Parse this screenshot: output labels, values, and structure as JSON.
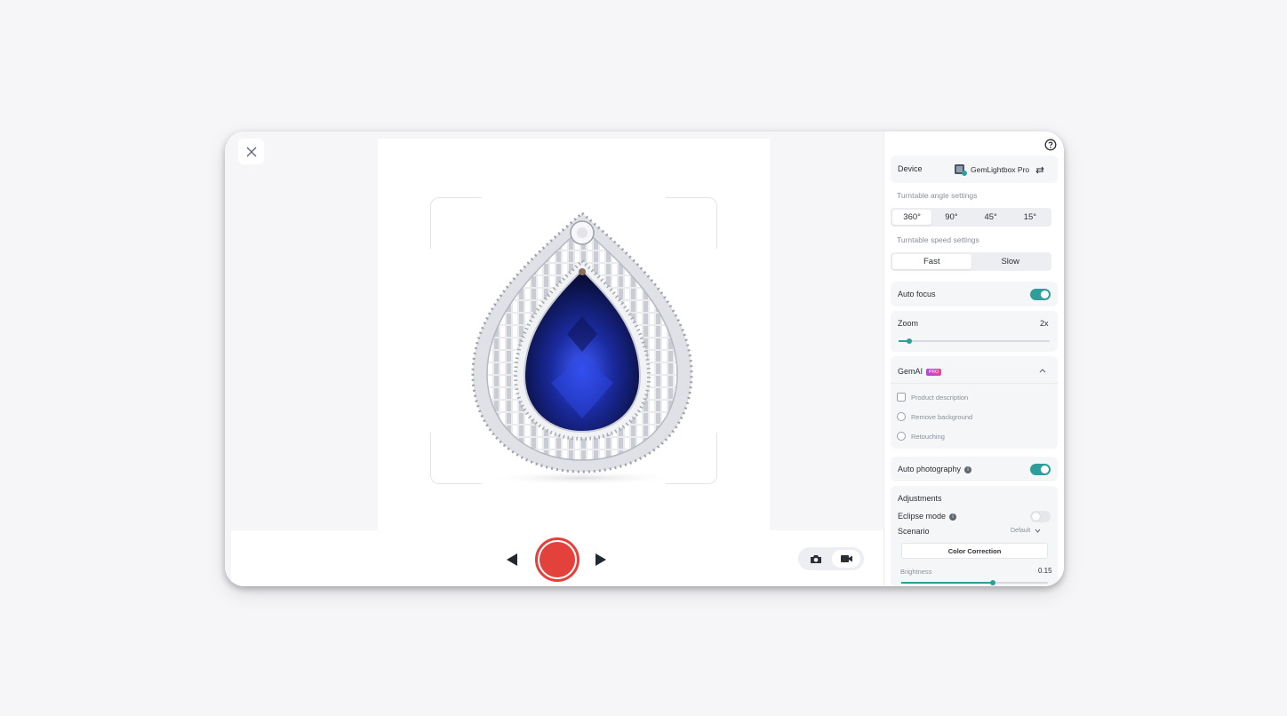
{
  "panel": {
    "device_label": "Device",
    "device_name": "GemLightbox Pro",
    "angle_title": "Turntable angle settings",
    "angles": [
      "360°",
      "90°",
      "45°",
      "15°"
    ],
    "speed_title": "Turntable speed settings",
    "speeds": [
      "Fast",
      "Slow"
    ],
    "auto_focus_label": "Auto focus",
    "auto_focus_on": true,
    "zoom_label": "Zoom",
    "zoom_value": "2x",
    "zoom_level": 0.06,
    "gemai_label": "GemAI",
    "gemai_badge": "PRO",
    "gemai_options": [
      "Product description",
      "Remove background",
      "Retouching"
    ],
    "auto_photo_label": "Auto photography",
    "auto_photo_on": true,
    "adjustments_label": "Adjustments",
    "eclipse_label": "Eclipse mode",
    "eclipse_on": false,
    "scenario_label": "Scenario",
    "scenario_value": "Default",
    "color_correction_label": "Color Correction",
    "brightness_label": "Brightness",
    "brightness_value": "0.15",
    "brightness_level": 0.6
  },
  "camera": {
    "mode": "video"
  },
  "colors": {
    "accent": "#2f9d9a",
    "record": "#e3413b",
    "gem": "#1a2a9c"
  }
}
